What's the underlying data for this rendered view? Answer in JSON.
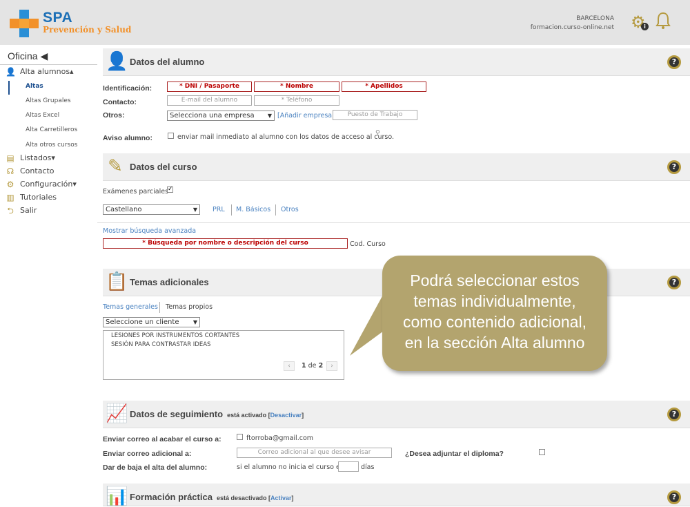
{
  "header": {
    "brand_name": "SPA",
    "brand_sub": "Prevención y Salud",
    "city": "BARCELONA",
    "url": "formacion.curso-online.net"
  },
  "sidebar": {
    "title": "Oficina ◀",
    "items": [
      {
        "label": "Alta alumnos▴",
        "icon": "user-icon"
      },
      {
        "label": "Listados▾",
        "icon": "list-icon"
      },
      {
        "label": "Contacto",
        "icon": "headset-icon"
      },
      {
        "label": "Configuración▾",
        "icon": "gear-icon"
      },
      {
        "label": "Tutoriales",
        "icon": "book-icon"
      },
      {
        "label": "Salir",
        "icon": "exit-icon"
      }
    ],
    "subitems": [
      "Altas",
      "Altas Grupales",
      "Altas Excel",
      "Alta Carretilleros",
      "Alta otros cursos"
    ]
  },
  "alumno": {
    "title": "Datos del alumno",
    "identificacion_label": "Identificación:",
    "contacto_label": "Contacto:",
    "otros_label": "Otros:",
    "aviso_label": "Aviso alumno:",
    "dni_ph": "* DNI / Pasaporte",
    "nombre_ph": "* Nombre",
    "apellidos_ph": "* Apellidos",
    "email_ph": "E-mail del alumno",
    "telefono_ph": "* Teléfono",
    "empresa_select": "Selecciona una empresa",
    "add_empresa": "[Añadir empresa]",
    "puesto_ph": "Puesto de Trabajo",
    "aviso_text": "enviar mail inmediato al alumno con los datos de acceso al curso."
  },
  "curso": {
    "title": "Datos del curso",
    "examenes_label": "Exámenes parciales",
    "idioma": "Castellano",
    "filters": [
      "PRL",
      "M. Básicos",
      "Otros"
    ],
    "advanced_link": "Mostrar búsqueda avanzada",
    "search_ph": "* Búsqueda por nombre o descripción del curso",
    "cod_label": "Cod. Curso"
  },
  "temas": {
    "title": "Temas adicionales",
    "tab_generales": "Temas generales",
    "tab_propios": "Temas propios",
    "client_select": "Seleccione un cliente",
    "items": [
      "LESIONES POR INSTRUMENTOS CORTANTES",
      "SESIÓN PARA CONTRASTAR IDEAS"
    ],
    "page_current": "1",
    "page_of": "de",
    "page_total": "2"
  },
  "seguimiento": {
    "title": "Datos de seguimiento",
    "status": "está activado",
    "status_link": "Desactivar",
    "correo_label": "Enviar correo al acabar el curso a:",
    "correo_value": "ftorroba@gmail.com",
    "adicional_label": "Enviar correo adicional a:",
    "adicional_ph": "Correo adicional al que desee avisar",
    "diploma_label": "¿Desea adjuntar el diploma?",
    "baja_label": "Dar de baja el alta del alumno:",
    "baja_text": "si el alumno no inicia el curso en",
    "dias": "días"
  },
  "practica": {
    "title": "Formación práctica",
    "status": "está desactivado",
    "status_link": "Activar"
  },
  "callout": {
    "line1": "Podrá seleccionar estos",
    "line2": "temas individualmente,",
    "line3": "como contenido adicional,",
    "line4": "en la sección Alta alumno"
  },
  "colors": {
    "accent_gold": "#b59a3f",
    "link_blue": "#4a82c0",
    "required_red": "#b00000",
    "callout": "#b3a46e"
  }
}
